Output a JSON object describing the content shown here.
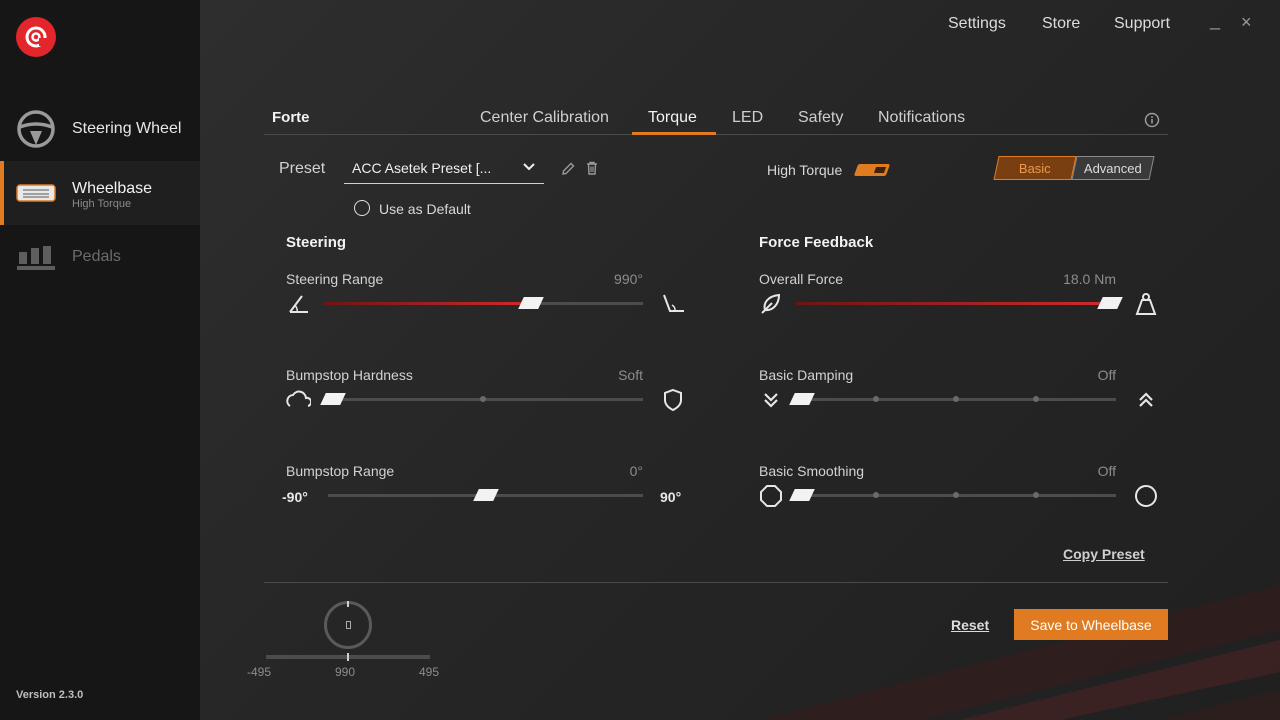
{
  "sidebar": {
    "items": [
      {
        "label": "Steering Wheel",
        "sub": ""
      },
      {
        "label": "Wheelbase",
        "sub": "High Torque"
      },
      {
        "label": "Pedals",
        "sub": ""
      }
    ],
    "version": "Version 2.3.0"
  },
  "topnav": {
    "settings": "Settings",
    "store": "Store",
    "support": "Support",
    "minimize": "_",
    "close": "×"
  },
  "device": {
    "name": "Forte"
  },
  "tabs": [
    "Center Calibration",
    "Torque",
    "LED",
    "Safety",
    "Notifications"
  ],
  "active_tab": "Torque",
  "preset": {
    "label": "Preset",
    "value": "ACC Asetek Preset [...",
    "default_label": "Use as Default"
  },
  "high_torque": {
    "label": "High Torque",
    "enabled": true
  },
  "mode": {
    "basic": "Basic",
    "advanced": "Advanced",
    "selected": "Basic"
  },
  "steering": {
    "title": "Steering",
    "range": {
      "label": "Steering Range",
      "value": "990°",
      "fraction": 0.65
    },
    "bumpstop_hardness": {
      "label": "Bumpstop Hardness",
      "value": "Soft",
      "fraction": 0.03
    },
    "bumpstop_range": {
      "label": "Bumpstop Range",
      "value": "0°",
      "min": "-90°",
      "max": "90°",
      "fraction": 0.5
    }
  },
  "ffb": {
    "title": "Force Feedback",
    "overall": {
      "label": "Overall Force",
      "value": "18.0 Nm",
      "fraction": 0.98
    },
    "damping": {
      "label": "Basic Damping",
      "value": "Off",
      "fraction": 0.02
    },
    "smoothing": {
      "label": "Basic Smoothing",
      "value": "Off",
      "fraction": 0.02
    }
  },
  "actions": {
    "copy_preset": "Copy Preset",
    "reset": "Reset",
    "save": "Save to Wheelbase"
  },
  "mini_wheel": {
    "left": "-495",
    "center": "990",
    "right": "495"
  },
  "colors": {
    "accent": "#e07b22",
    "logo": "#e3262c",
    "fill": "#d22a2a"
  }
}
